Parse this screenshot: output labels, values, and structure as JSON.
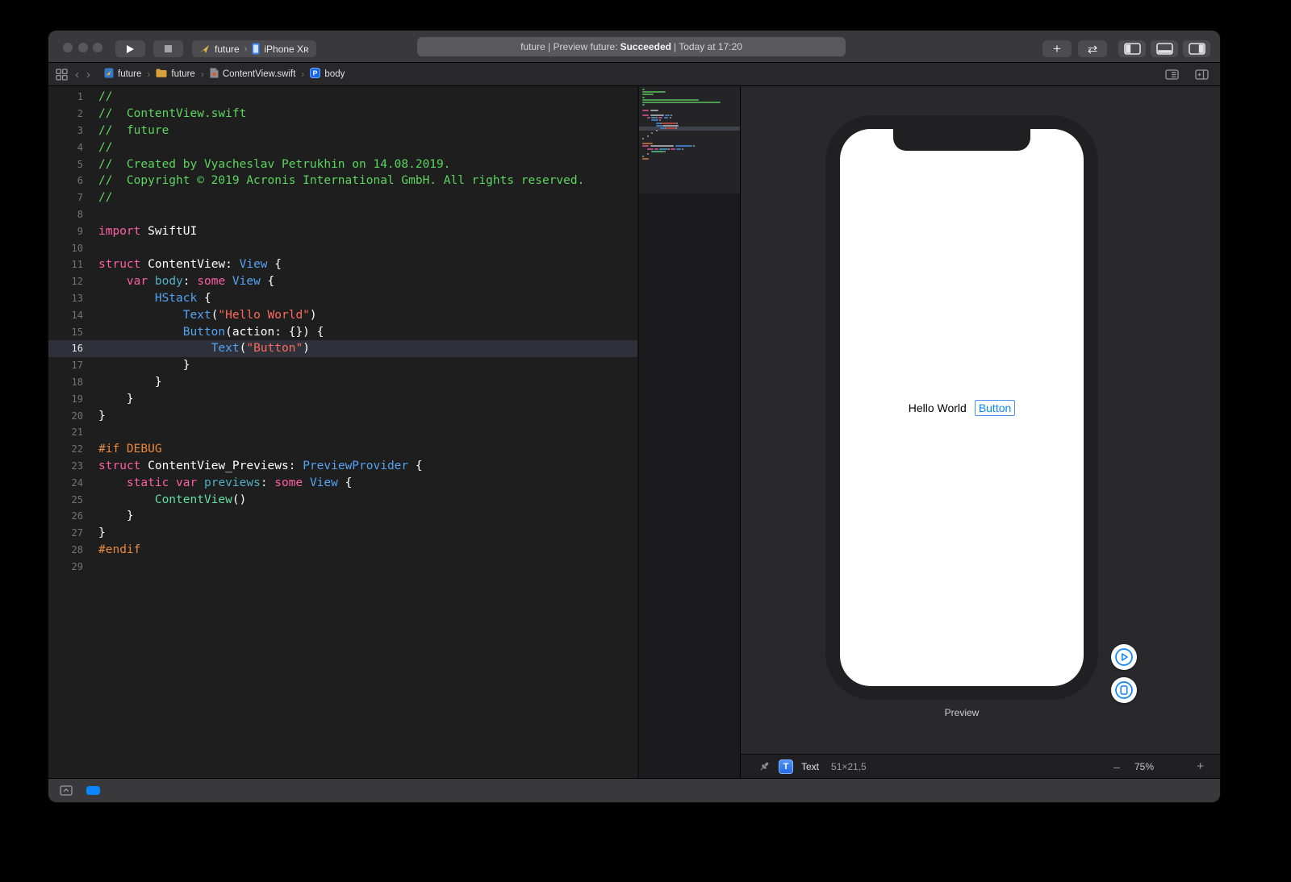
{
  "toolbar": {
    "scheme_target": "future",
    "scheme_device": "iPhone Xʀ",
    "status_prefix": "future | Preview future: ",
    "status_bold": "Succeeded",
    "status_suffix": " | Today at 17:20",
    "icons": {
      "plus": "+",
      "swap": "⇄"
    }
  },
  "jumpbar": {
    "separator": "›",
    "back": "‹",
    "forward": "›",
    "items": [
      {
        "icon": "project-file-icon",
        "label": "future"
      },
      {
        "icon": "folder-icon",
        "label": "future"
      },
      {
        "icon": "swift-file-icon",
        "label": "ContentView.swift"
      },
      {
        "icon": "property-badge-icon",
        "label": "body"
      }
    ]
  },
  "editor": {
    "highlight_line": 16,
    "lines": [
      {
        "n": 1,
        "tokens": [
          [
            "com",
            "//"
          ]
        ]
      },
      {
        "n": 2,
        "tokens": [
          [
            "com",
            "//  ContentView.swift"
          ]
        ]
      },
      {
        "n": 3,
        "tokens": [
          [
            "com",
            "//  future"
          ]
        ]
      },
      {
        "n": 4,
        "tokens": [
          [
            "com",
            "//"
          ]
        ]
      },
      {
        "n": 5,
        "tokens": [
          [
            "com",
            "//  Created by Vyacheslav Petrukhin on 14.08.2019."
          ]
        ]
      },
      {
        "n": 6,
        "tokens": [
          [
            "com",
            "//  Copyright © 2019 Acronis International GmbH. All rights reserved."
          ]
        ]
      },
      {
        "n": 7,
        "tokens": [
          [
            "com",
            "//"
          ]
        ]
      },
      {
        "n": 8,
        "tokens": []
      },
      {
        "n": 9,
        "tokens": [
          [
            "kw",
            "import"
          ],
          [
            "plain",
            " SwiftUI"
          ]
        ]
      },
      {
        "n": 10,
        "tokens": []
      },
      {
        "n": 11,
        "tokens": [
          [
            "kw",
            "struct"
          ],
          [
            "plain",
            " ContentView: "
          ],
          [
            "type",
            "View"
          ],
          [
            "plain",
            " {"
          ]
        ]
      },
      {
        "n": 12,
        "tokens": [
          [
            "plain",
            "    "
          ],
          [
            "kw",
            "var"
          ],
          [
            "plain",
            " "
          ],
          [
            "decl",
            "body"
          ],
          [
            "plain",
            ": "
          ],
          [
            "kw",
            "some"
          ],
          [
            "plain",
            " "
          ],
          [
            "type",
            "View"
          ],
          [
            "plain",
            " {"
          ]
        ]
      },
      {
        "n": 13,
        "tokens": [
          [
            "plain",
            "        "
          ],
          [
            "type",
            "HStack"
          ],
          [
            "plain",
            " {"
          ]
        ]
      },
      {
        "n": 14,
        "tokens": [
          [
            "plain",
            "            "
          ],
          [
            "type",
            "Text"
          ],
          [
            "plain",
            "("
          ],
          [
            "str",
            "\"Hello World\""
          ],
          [
            "plain",
            ")"
          ]
        ]
      },
      {
        "n": 15,
        "tokens": [
          [
            "plain",
            "            "
          ],
          [
            "type",
            "Button"
          ],
          [
            "plain",
            "(action: {}) {"
          ]
        ]
      },
      {
        "n": 16,
        "tokens": [
          [
            "plain",
            "                "
          ],
          [
            "type",
            "Text"
          ],
          [
            "plain",
            "("
          ],
          [
            "str",
            "\"Button\""
          ],
          [
            "plain",
            ")"
          ]
        ]
      },
      {
        "n": 17,
        "tokens": [
          [
            "plain",
            "            }"
          ]
        ]
      },
      {
        "n": 18,
        "tokens": [
          [
            "plain",
            "        }"
          ]
        ]
      },
      {
        "n": 19,
        "tokens": [
          [
            "plain",
            "    }"
          ]
        ]
      },
      {
        "n": 20,
        "tokens": [
          [
            "plain",
            "}"
          ]
        ]
      },
      {
        "n": 21,
        "tokens": []
      },
      {
        "n": 22,
        "tokens": [
          [
            "pp",
            "#if DEBUG"
          ]
        ]
      },
      {
        "n": 23,
        "tokens": [
          [
            "kw",
            "struct"
          ],
          [
            "plain",
            " ContentView_Previews: "
          ],
          [
            "type",
            "PreviewProvider"
          ],
          [
            "plain",
            " {"
          ]
        ]
      },
      {
        "n": 24,
        "tokens": [
          [
            "plain",
            "    "
          ],
          [
            "kw",
            "static"
          ],
          [
            "plain",
            " "
          ],
          [
            "kw",
            "var"
          ],
          [
            "plain",
            " "
          ],
          [
            "decl",
            "previews"
          ],
          [
            "plain",
            ": "
          ],
          [
            "kw",
            "some"
          ],
          [
            "plain",
            " "
          ],
          [
            "type",
            "View"
          ],
          [
            "plain",
            " {"
          ]
        ]
      },
      {
        "n": 25,
        "tokens": [
          [
            "plain",
            "        "
          ],
          [
            "proj",
            "ContentView"
          ],
          [
            "plain",
            "()"
          ]
        ]
      },
      {
        "n": 26,
        "tokens": [
          [
            "plain",
            "    }"
          ]
        ]
      },
      {
        "n": 27,
        "tokens": [
          [
            "plain",
            "}"
          ]
        ]
      },
      {
        "n": 28,
        "tokens": [
          [
            "pp",
            "#endif"
          ]
        ]
      },
      {
        "n": 29,
        "tokens": []
      }
    ]
  },
  "preview": {
    "hello_text": "Hello World",
    "button_text": "Button",
    "caption": "Preview",
    "selection_type": "Text",
    "selection_size": "51×21,5",
    "zoom_level": "75%",
    "zoom_minus": "–",
    "zoom_plus": "+"
  },
  "colors": {
    "accent_blue": "#0A84FF",
    "selection_border": "#4A90F7",
    "syntax": {
      "plain": "#FFFFFF",
      "com": "#5CD65E",
      "kw": "#FC5FA3",
      "type": "#54A3F2",
      "str": "#FC6A5D",
      "decl": "#4FB0C6",
      "pp": "#E8893E",
      "proj": "#63DCA2"
    },
    "minimap": {
      "plain": "#9A9AA0",
      "com": "#4E9A4E",
      "kw": "#B0487E",
      "type": "#3E76B8",
      "str": "#A84A42",
      "decl": "#3E87A0",
      "pp": "#A8663A",
      "proj": "#46A07A"
    }
  }
}
